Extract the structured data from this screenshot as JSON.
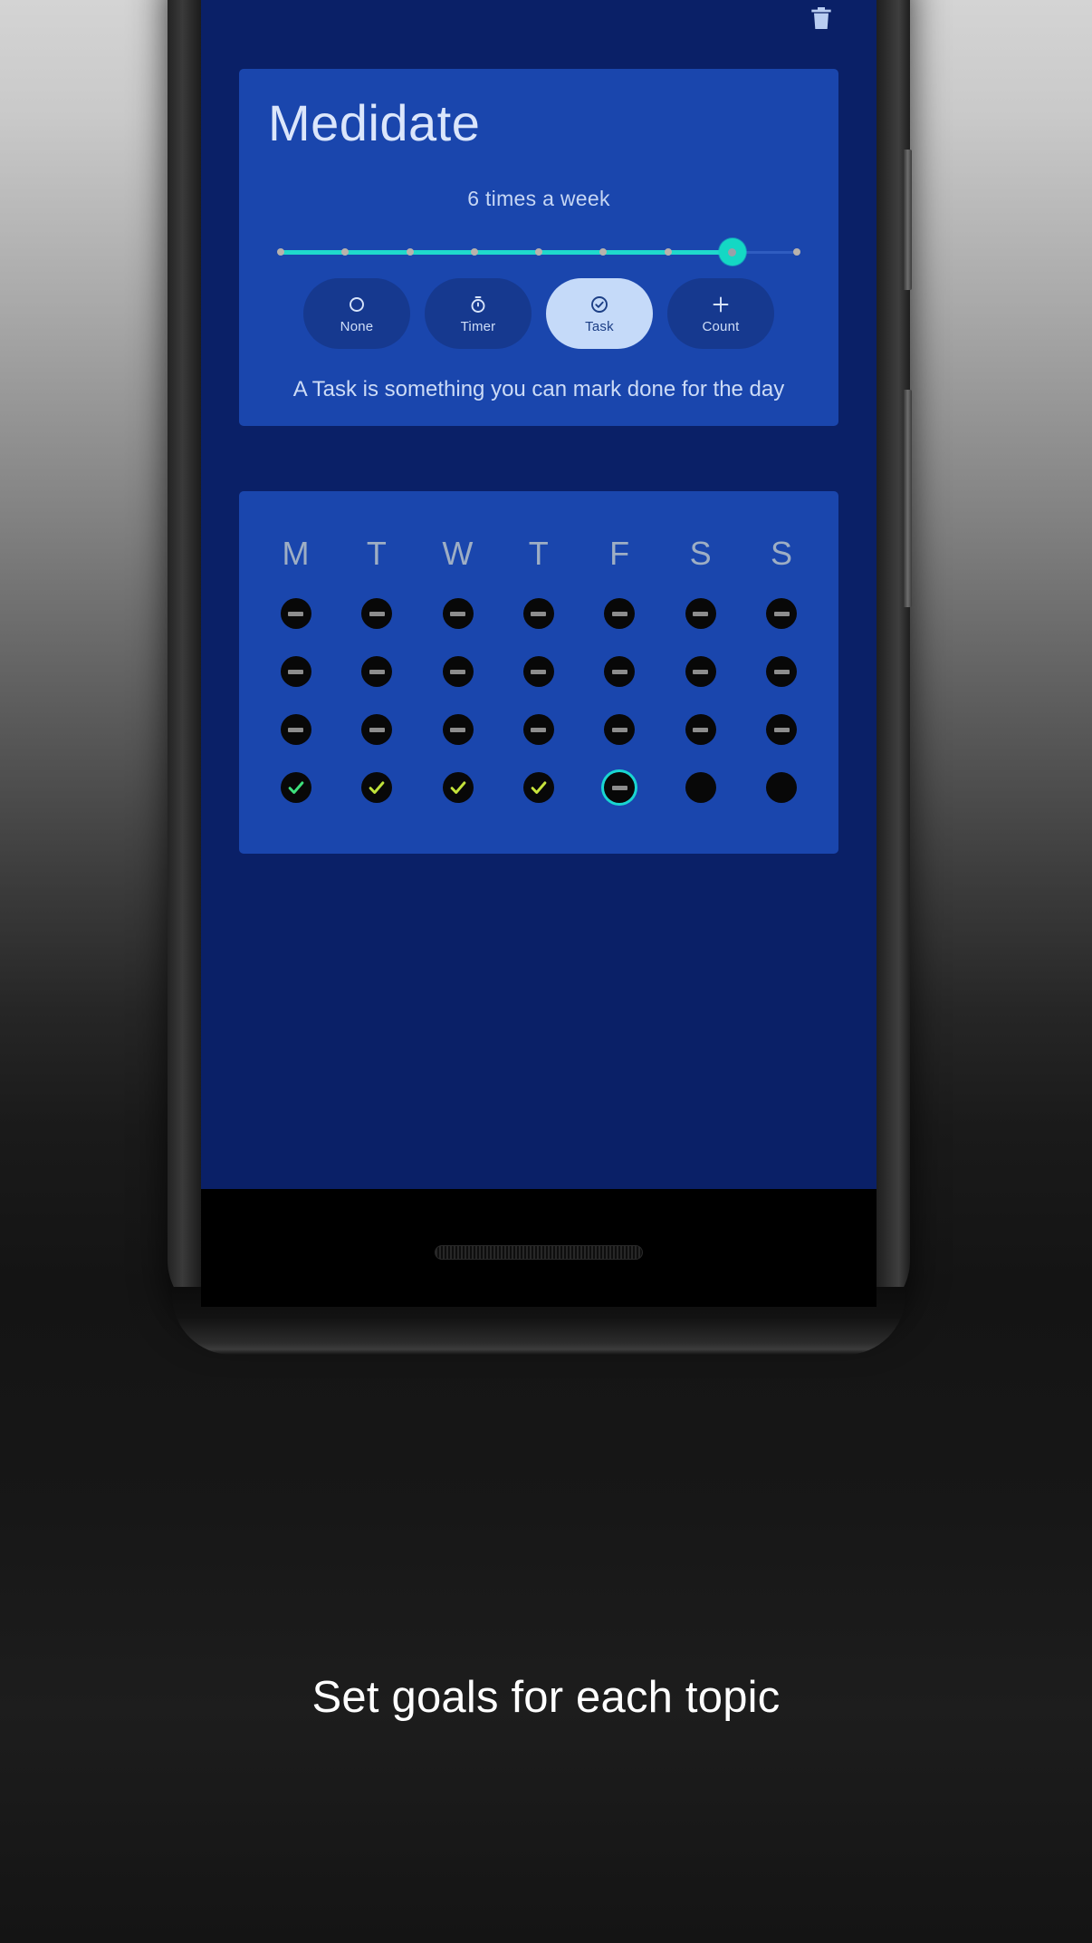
{
  "promo": {
    "caption": "Set goals for each topic"
  },
  "app_bar": {
    "delete_icon": "trash-icon"
  },
  "goal_card": {
    "habit_title": "Medidate",
    "frequency_label": "6 times a week",
    "slider": {
      "min": 0,
      "max": 8,
      "value": 7,
      "ticks": 9,
      "active_color": "#1fd9cc",
      "inactive_color": "#2f5cc0",
      "thumb_color": "#14d8c4",
      "tick_color": "#b8b2ac"
    },
    "goal_types": [
      {
        "label": "None",
        "icon": "circle-outline-icon",
        "selected": false
      },
      {
        "label": "Timer",
        "icon": "stopwatch-icon",
        "selected": false
      },
      {
        "label": "Task",
        "icon": "check-circle-icon",
        "selected": true
      },
      {
        "label": "Count",
        "icon": "plus-icon",
        "selected": false
      }
    ],
    "description": "A Task is something you can mark done for the day"
  },
  "calendar_card": {
    "weekdays": [
      "M",
      "T",
      "W",
      "T",
      "F",
      "S",
      "S"
    ],
    "rows": [
      [
        {
          "state": "none"
        },
        {
          "state": "none"
        },
        {
          "state": "none"
        },
        {
          "state": "none"
        },
        {
          "state": "none"
        },
        {
          "state": "none"
        },
        {
          "state": "none"
        }
      ],
      [
        {
          "state": "none"
        },
        {
          "state": "none"
        },
        {
          "state": "none"
        },
        {
          "state": "none"
        },
        {
          "state": "none"
        },
        {
          "state": "none"
        },
        {
          "state": "none"
        }
      ],
      [
        {
          "state": "none"
        },
        {
          "state": "none"
        },
        {
          "state": "none"
        },
        {
          "state": "none"
        },
        {
          "state": "none"
        },
        {
          "state": "none"
        },
        {
          "state": "none"
        }
      ],
      [
        {
          "state": "done",
          "color": "#3ee07c"
        },
        {
          "state": "done",
          "color": "#bfe23a"
        },
        {
          "state": "done",
          "color": "#c3e33a"
        },
        {
          "state": "done",
          "color": "#c8e43c"
        },
        {
          "state": "today"
        },
        {
          "state": "empty"
        },
        {
          "state": "empty"
        }
      ]
    ]
  },
  "colors": {
    "screen_bg": "#0a2067",
    "card_bg": "#1a46ad",
    "status_accent": "#5910e8",
    "accent_cyan": "#19d6d1",
    "chip_selected_bg": "#c5daf9"
  }
}
